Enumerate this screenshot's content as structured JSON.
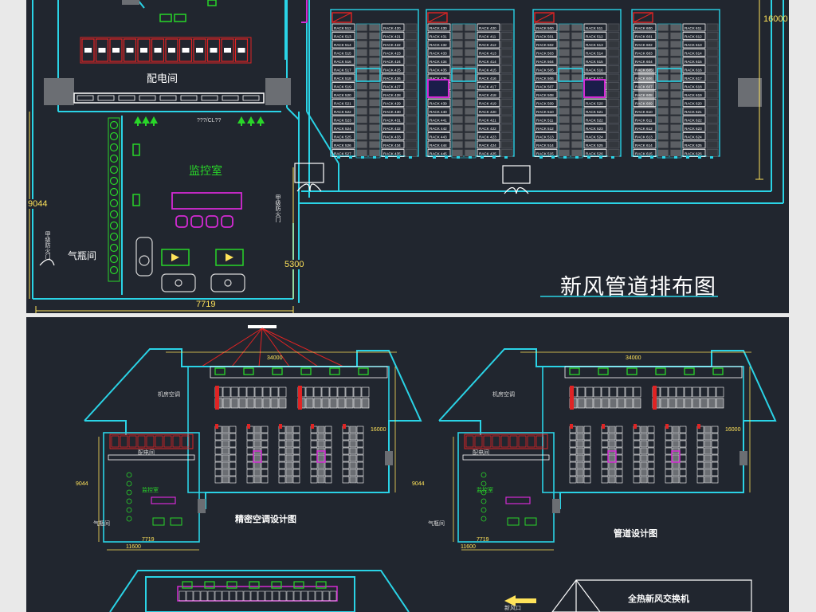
{
  "colors": {
    "background": "#21262f",
    "page": "#e9e9e9",
    "wall_cyan": "#2ad3e6",
    "dimension_yellow": "#ffe35a",
    "rack_red": "#e02424",
    "unit_green": "#29d629",
    "magenta": "#d42ad4",
    "white": "#ffffff",
    "grey_block": "#6b6e73"
  },
  "top_panel": {
    "title": "新风管道排布图",
    "rooms": {
      "power_room": "配电间",
      "monitor_room": "监控室",
      "gas_cylinder_room": "气瓶间"
    },
    "dimensions": {
      "right_height": "16000",
      "left_height": "9044",
      "bottom_width": "7719",
      "mid_height": "5300"
    },
    "small_labels": {
      "power_tag": "???/CL??",
      "door_note_left": "甲级防火门",
      "door_note_mid": "甲级防火门"
    },
    "rack_columns": [
      {
        "left": [
          "RACK 512",
          "RACK 513",
          "RACK 514",
          "RACK 515",
          "RACK 516",
          "RACK 517",
          "RACK 518",
          "RACK 519",
          "RACK 520",
          "RACK 521",
          "RACK 522",
          "RACK 523",
          "RACK 524",
          "RACK 525",
          "RACK 526",
          "RACK 527"
        ],
        "right": [
          "RACK 420",
          "RACK 421",
          "RACK 422",
          "RACK 423",
          "RACK 424",
          "RACK 425",
          "RACK 426",
          "RACK 427",
          "RACK 428",
          "RACK 429",
          "RACK 430",
          "RACK 431",
          "RACK 432",
          "RACK 433",
          "RACK 434",
          "RACK 435"
        ]
      },
      {
        "left": [
          "RACK 430",
          "RACK 431",
          "RACK 432",
          "RACK 433",
          "RACK 434",
          "RACK 435",
          "RACK 436",
          "RACK 437",
          "RACK 438",
          "RACK 439",
          "RACK 440",
          "RACK 441",
          "RACK 442",
          "RACK 443",
          "RACK 444",
          "RACK 445"
        ],
        "right": [
          "RACK 420",
          "RACK 411",
          "RACK 412",
          "RACK 413",
          "RACK 414",
          "RACK 415",
          "RACK 416",
          "RACK 417",
          "RACK 418",
          "RACK 419",
          "RACK 420",
          "RACK 421",
          "RACK 422",
          "RACK 423",
          "RACK 424",
          "RACK 425"
        ]
      },
      {
        "left": [
          "RACK 500",
          "RACK 501",
          "RACK 502",
          "RACK 503",
          "RACK 504",
          "RACK 505",
          "RACK 506",
          "RACK 507",
          "RACK 508",
          "RACK 509",
          "RACK 510",
          "RACK 511",
          "RACK 512",
          "RACK 513",
          "RACK 514",
          "RACK 515"
        ],
        "right": [
          "RACK 511",
          "RACK 512",
          "RACK 513",
          "RACK 514",
          "RACK 515",
          "RACK 516",
          "RACK 517",
          "RACK 518",
          "RACK 519",
          "RACK 520",
          "RACK 521",
          "RACK 522",
          "RACK 523",
          "RACK 524",
          "RACK 525",
          "RACK 526"
        ]
      },
      {
        "left": [
          "RACK 600",
          "RACK 601",
          "RACK 602",
          "RACK 603",
          "RACK 604",
          "RACK 605",
          "RACK 606",
          "RACK 607",
          "RACK 608",
          "RACK 609",
          "RACK 610",
          "RACK 611",
          "RACK 612",
          "RACK 613",
          "RACK 614",
          "RACK 615"
        ],
        "right": [
          "RACK 611",
          "RACK 612",
          "RACK 613",
          "RACK 614",
          "RACK 615",
          "RACK 616",
          "RACK 617",
          "RACK 618",
          "RACK 619",
          "RACK 620",
          "RACK 621",
          "RACK 622",
          "RACK 623",
          "RACK 624",
          "RACK 625",
          "RACK 626"
        ]
      }
    ]
  },
  "bottom_panel": {
    "plan_left_title": "精密空调设计图",
    "plan_right_title": "管道设计图",
    "plan_left_rooms": {
      "power_room": "配电间",
      "monitor_room": "监控室",
      "gas_room": "气瓶间",
      "ac_room": "机房空调"
    },
    "plan_right_rooms": {
      "power_room": "配电间",
      "monitor_room": "监控室",
      "gas_room": "气瓶间",
      "ac_room": "机房空调"
    },
    "dims_left": {
      "top_width": "34000",
      "width_bottom": "7719",
      "height_left": "9044",
      "height_right": "16000",
      "bottom_width": "11600"
    },
    "dims_right": {
      "top_width": "34000",
      "width_bottom": "7719",
      "height_left": "9044",
      "height_right": "16000",
      "bottom_width": "11600"
    },
    "fresh_air_unit_label": "全热新风交换机",
    "air_inlet_label": "新风口"
  }
}
